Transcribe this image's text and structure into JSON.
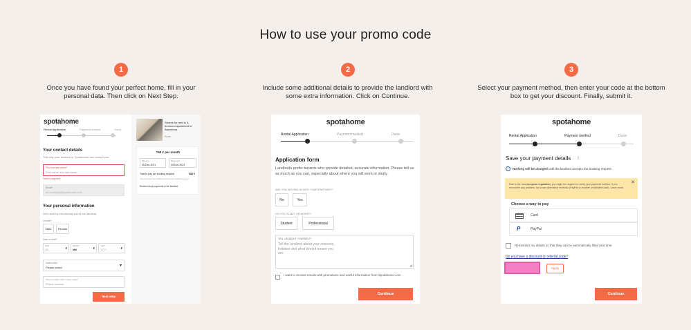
{
  "title": "How to use your promo code",
  "steps": [
    {
      "num": "1",
      "text": "Once you have found your perfect home, fill in your personal data. Then click on Next Step."
    },
    {
      "num": "2",
      "text": "Include some additional details to provide the landlord with some extra information. Click on Continue."
    },
    {
      "num": "3",
      "text": "Select your payment method, then enter your code at the bottom box to get your discount. Finally, submit it."
    }
  ],
  "brand": "spotahome",
  "tabs": {
    "t1": "Rental Application",
    "t2": "Payment method",
    "t3": "Done"
  },
  "card1": {
    "contact_heading": "Your contact details",
    "contact_sub": "This way your landlord or Spotahome can contact you",
    "name_label": "First and last name*",
    "name_placeholder": "First name and last name",
    "required": "Field is required",
    "email_label": "Email*",
    "email_value": "sh.example@spotahome.com",
    "personal_heading": "Your personal information",
    "personal_sub": "Let's start by introducing you to the landlord",
    "gender_label": "Gender*",
    "male": "Male",
    "female": "Female",
    "dob_label": "Date of birth*",
    "day_label": "Day*",
    "day_value": "DD",
    "month_label": "Month*",
    "month_value": "MM",
    "year_label": "Year*",
    "year_value": "YYYY",
    "nat_label": "Nationality*",
    "nat_value": "Please select",
    "phone_label": "Phone number (with country code)*",
    "phone_placeholder": "Phone number",
    "next_button": "Next step",
    "listing_title": "Rooms for rent in 3-bedroom apartment in Barcelona",
    "listing_sub": "Room",
    "price": "790 € per month",
    "movein_label": "Move-in",
    "movein_value": "05-Dec-2021",
    "moveout_label": "Move-out",
    "moveout_value": "05-Nov-2022",
    "total_label": "Total to pay per booking request",
    "total_value": "982 €",
    "total_sub": "You pay only if the landlord accepts your booking request",
    "review_link": "Review future payments to the landlord"
  },
  "card2": {
    "heading": "Application form",
    "intro": "Landlords prefer tenants who provide detailed, accurate information. Please tell us as much as you can, especially about where you will work or study.",
    "q1": "ARE YOU MOVING IN WITH YOUR PARTNER?*",
    "no": "No",
    "yes": "Yes",
    "q2": "DO YOU STUDY OR WORK?*",
    "student": "Student",
    "professional": "Professional",
    "q3": "TELL US ABOUT YOURSELF*",
    "about_placeholder": "Tell the landlord about your interests, hobbies and what kind of tenant you are.",
    "promo_text": "I want to receive emails with promotions and useful information from Spotahome.com",
    "continue": "Continue"
  },
  "card3": {
    "heading": "Save your payment details",
    "charged_bold": "Nothing will be charged",
    "charged_rest": "until the landlord accepts the booking request.",
    "notice_pre": "Due to the new",
    "notice_bold": "european regulation",
    "notice_rest": ", you might be required to verify your payment method. If you encounter any problem, try to use alternative methods (PayPal or another credit/debit card). Learn more.",
    "choose": "Choose a way to pay",
    "card": "Card",
    "paypal": "PayPal",
    "remember": "Remember my details so that they can be automatically filled next time",
    "discount_link": "Do you have a discount or referral code?",
    "apply": "Apply",
    "continue": "Continue"
  },
  "colors": {
    "accent": "#f26b46",
    "background": "#f5efeb",
    "highlight": "#f06bb8",
    "notice": "#fde6a8"
  }
}
